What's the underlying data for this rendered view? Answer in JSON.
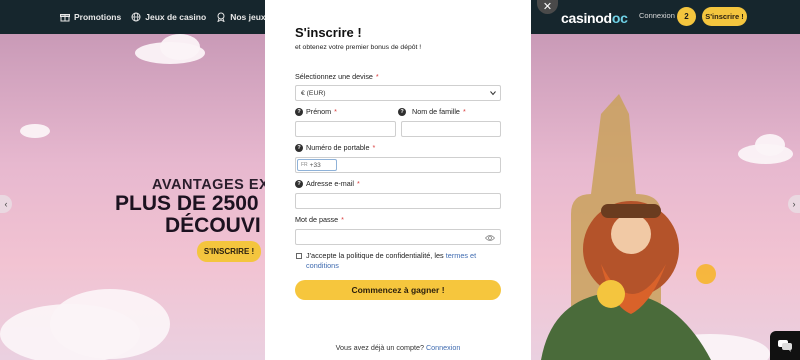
{
  "nav": {
    "items": [
      {
        "label": "Promotions",
        "icon": "gift-icon"
      },
      {
        "label": "Jeux de casino",
        "icon": "globe-icon"
      },
      {
        "label": "Nos jeux Live",
        "icon": "medal-icon"
      }
    ]
  },
  "header": {
    "logo_main": "casinod",
    "logo_accent": "oc",
    "login_label": "Connexion",
    "badge_count": "2",
    "signup_label": "S'inscrire !"
  },
  "hero": {
    "line1": "AVANTAGES EXC",
    "line2": "PLUS DE 2500",
    "line3": "DÉCOUVI",
    "cta_label": "S'INSCRIRE !",
    "prev_arrow": "‹",
    "next_arrow": "›"
  },
  "modal": {
    "close_label": "✕",
    "title": "S'inscrire !",
    "subtitle": "et obtenez votre premier bonus de dépôt !",
    "currency": {
      "label": "Sélectionnez une devise",
      "required_mark": "*",
      "value": "€ (EUR)"
    },
    "first_name": {
      "label": "Prénom",
      "required_mark": "*",
      "help_mark": "?"
    },
    "last_name": {
      "label": "Nom de famille",
      "required_mark": "*",
      "help_mark": "?"
    },
    "phone": {
      "label": "Numéro de portable",
      "required_mark": "*",
      "help_mark": "?",
      "country_code": "FR",
      "prefix": "+33"
    },
    "email": {
      "label": "Adresse e-mail",
      "required_mark": "*",
      "help_mark": "?"
    },
    "password": {
      "label": "Mot de passe",
      "required_mark": "*"
    },
    "consent": {
      "text": "J'accepte la politique de confidentialité, les",
      "link": "termes et conditions"
    },
    "submit_label": "Commencez à gagner !",
    "footer_text": "Vous avez déjà un compte?",
    "footer_link": "Connexion"
  },
  "colors": {
    "accent": "#f4c53e",
    "header_bg": "#16262d",
    "link": "#3f6bb0",
    "required": "#d93b3b"
  }
}
